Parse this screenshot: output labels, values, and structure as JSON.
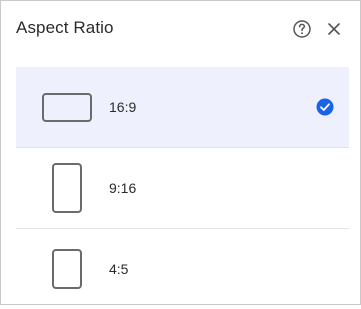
{
  "header": {
    "title": "Aspect Ratio",
    "help_icon": "help-circle-icon",
    "close_icon": "close-icon"
  },
  "options": [
    {
      "label": "16:9",
      "icon": "landscape-rect-icon",
      "selected": true
    },
    {
      "label": "9:16",
      "icon": "portrait-rect-icon",
      "selected": false
    },
    {
      "label": "4:5",
      "icon": "portrait-rect-icon",
      "selected": false
    }
  ],
  "colors": {
    "selected_background": "#eef0fd",
    "check_accent": "#1a63e8",
    "shape_stroke": "#6b6b6b"
  }
}
